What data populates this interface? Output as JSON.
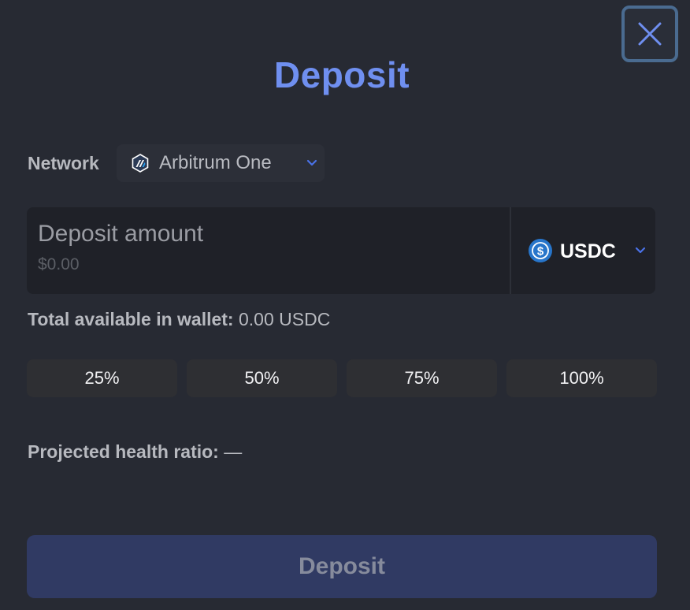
{
  "modal": {
    "title": "Deposit",
    "close_icon": "close-icon"
  },
  "network": {
    "label": "Network",
    "selected": "Arbitrum One",
    "icon": "arbitrum-icon"
  },
  "amount": {
    "placeholder": "Deposit amount",
    "value": "",
    "usd_value": "$0.00"
  },
  "token": {
    "selected": "USDC",
    "icon": "usdc-icon"
  },
  "wallet": {
    "label": "Total available in wallet:",
    "value": "0.00 USDC"
  },
  "percent_buttons": [
    "25%",
    "50%",
    "75%",
    "100%"
  ],
  "health": {
    "label": "Projected health ratio:",
    "value": "—"
  },
  "submit": {
    "label": "Deposit"
  },
  "colors": {
    "background": "#272a33",
    "accent": "#6f8ff0",
    "submit_disabled": "#303a63"
  }
}
